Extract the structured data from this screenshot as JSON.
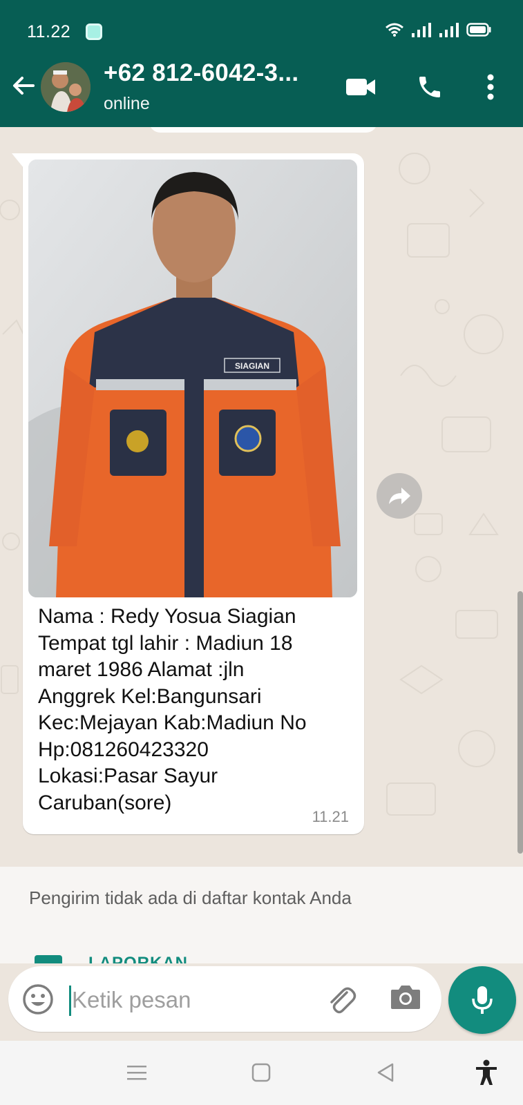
{
  "status_bar": {
    "time": "11.22"
  },
  "header": {
    "contact_name": "+62 812-6042-3...",
    "contact_status": "online",
    "icons": [
      "back-arrow-icon",
      "video-call-icon",
      "phone-icon",
      "more-vert-icon"
    ]
  },
  "message": {
    "caption": "Nama : Redy Yosua Siagian\nTempat tgl lahir : Madiun 18\nmaret 1986 Alamat :jln\nAnggrek Kel:Bangunsari\nKec:Mejayan Kab:Madiun No\nHp:081260423320\nLokasi:Pasar Sayur\nCaruban(sore)",
    "time": "11.21",
    "photo_badge": "SIAGIAN"
  },
  "unknown_sender": {
    "notice": "Pengirim tidak ada di daftar kontak Anda",
    "report_label": "LAPORKAN"
  },
  "composer": {
    "placeholder": "Ketik pesan"
  },
  "colors": {
    "header": "#075e54",
    "accent": "#128c7e",
    "chat_bg": "#ece5dd"
  }
}
